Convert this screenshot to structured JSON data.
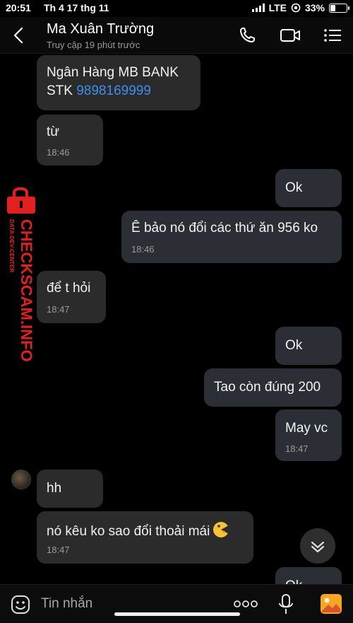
{
  "status_bar": {
    "time": "20:51",
    "date": "Th 4 17 thg 11",
    "network": "LTE",
    "battery": "33%",
    "battery_level": 0.33
  },
  "header": {
    "contact_name": "Ma Xuân Trường",
    "contact_status": "Truy cập 19 phút trước",
    "icons": [
      "back-icon",
      "phone-icon",
      "video-icon",
      "menu-icon"
    ]
  },
  "messages": [
    {
      "side": "in",
      "line1": "Ngân Hàng MB BANK",
      "line2_prefix": "STK ",
      "line2_link": "9898169999"
    },
    {
      "side": "in",
      "text": "từ",
      "time": "18:46"
    },
    {
      "side": "out",
      "text": "Ok"
    },
    {
      "side": "out",
      "text": "Ê bảo nó đổi các thứ ăn 956 ko",
      "time": "18:46"
    },
    {
      "side": "in",
      "text": "để t hỏi",
      "time": "18:47"
    },
    {
      "side": "out",
      "text": "Ok"
    },
    {
      "side": "out",
      "text": "Tao còn đúng 200"
    },
    {
      "side": "out",
      "text": "May vc",
      "time": "18:47"
    },
    {
      "side": "in",
      "text": "hh"
    },
    {
      "side": "in",
      "text": "nó kêu ko sao đổi thoải mái",
      "time": "18:47",
      "emoji": "pacman-face-emoji"
    },
    {
      "side": "out",
      "text": "Ok"
    }
  ],
  "watermark": {
    "text": "CHECKSCAM.INFO",
    "sub": "DATA-DEV-CENTER"
  },
  "input_bar": {
    "placeholder": "Tin nhắn",
    "more_label": "ooo"
  },
  "colors": {
    "background": "#000000",
    "bubble": "#2b2b2b",
    "link": "#3c8ff0",
    "watermark": "#e3201f"
  }
}
